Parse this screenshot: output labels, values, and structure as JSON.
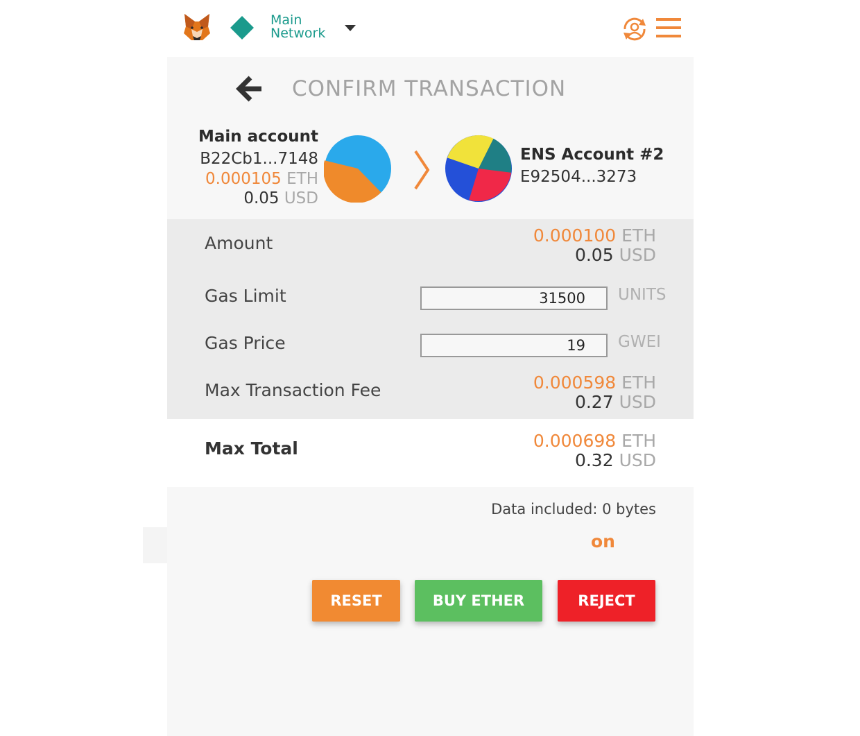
{
  "header": {
    "network_name": "Main Network",
    "icons": {
      "logo": "metamask-fox-icon",
      "network": "diamond-icon",
      "caret": "caret-down-icon",
      "account": "account-switch-icon",
      "menu": "hamburger-menu-icon"
    },
    "colors": {
      "network": "#1a9a8c",
      "accent": "#f0883a"
    }
  },
  "title": "CONFIRM TRANSACTION",
  "from": {
    "name": "Main account",
    "address": "B22Cb1...7148",
    "eth_value": "0.000105",
    "eth_unit": "ETH",
    "usd_value": "0.05",
    "usd_unit": "USD"
  },
  "to": {
    "name": "ENS Account #2",
    "address": "E92504...3273"
  },
  "details": {
    "amount": {
      "label": "Amount",
      "eth_value": "0.000100",
      "eth_unit": "ETH",
      "usd_value": "0.05",
      "usd_unit": "USD"
    },
    "gas_limit": {
      "label": "Gas Limit",
      "value": "31500",
      "unit": "UNITS"
    },
    "gas_price": {
      "label": "Gas Price",
      "value": "19",
      "unit": "GWEI"
    },
    "max_fee": {
      "label": "Max Transaction Fee",
      "eth_value": "0.000598",
      "eth_unit": "ETH",
      "usd_value": "0.27",
      "usd_unit": "USD"
    }
  },
  "total": {
    "label": "Max Total",
    "eth_value": "0.000698",
    "eth_unit": "ETH",
    "usd_value": "0.32",
    "usd_unit": "USD"
  },
  "data_included": "Data included: 0 bytes",
  "partial_text": "on",
  "buttons": {
    "reset": "RESET",
    "buy_ether": "BUY ETHER",
    "reject": "REJECT",
    "colors": {
      "reset": "#f18a32",
      "buy_ether": "#5cbf60",
      "reject": "#ee2128"
    }
  }
}
